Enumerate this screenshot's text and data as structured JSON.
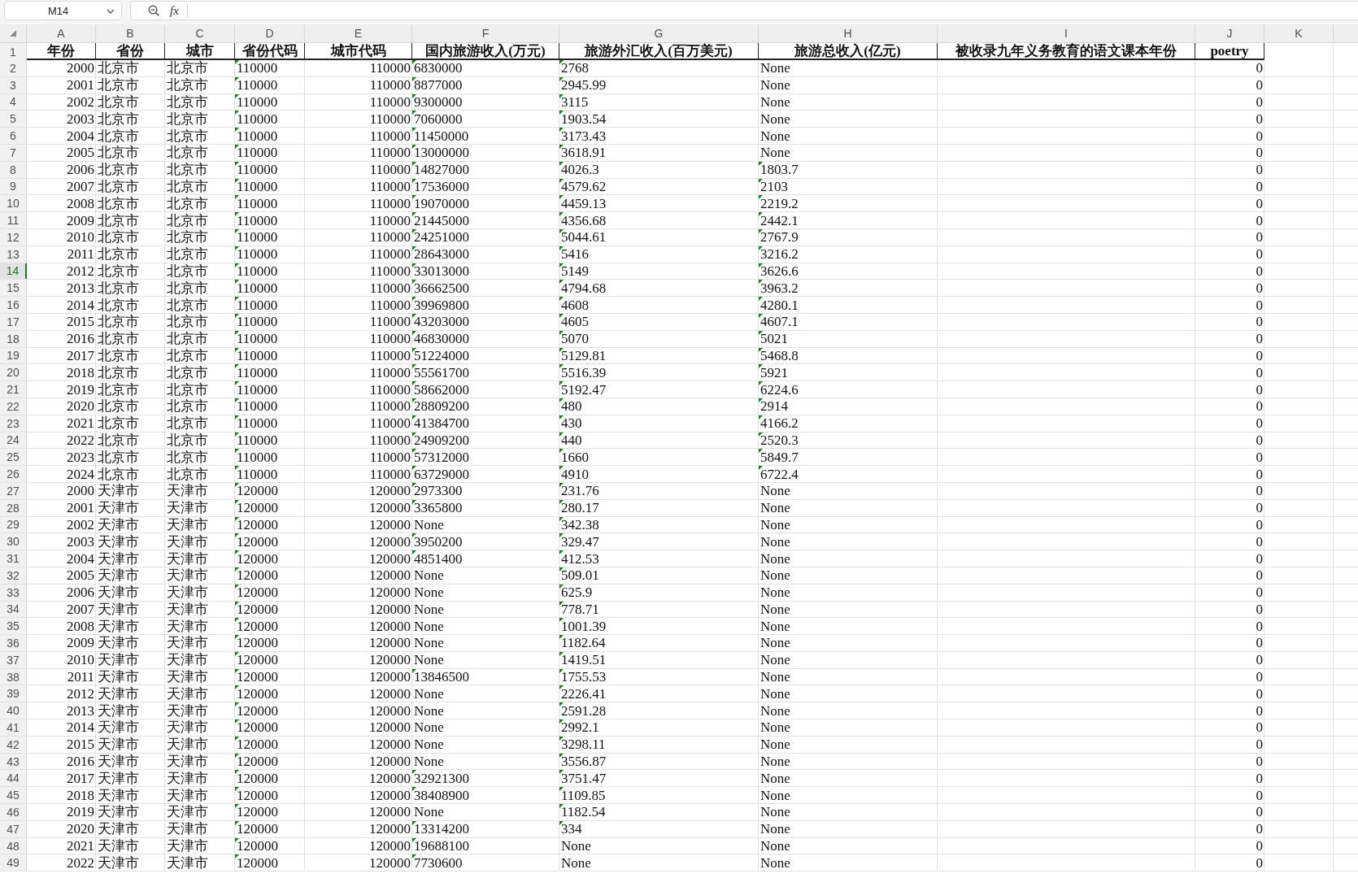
{
  "name_box": {
    "value": "M14"
  },
  "formula_bar": {
    "function_label": "fx"
  },
  "sheet": {
    "columns": [
      {
        "letter": "A",
        "title": "年份",
        "kind": "number"
      },
      {
        "letter": "B",
        "title": "省份",
        "kind": "text"
      },
      {
        "letter": "C",
        "title": "城市",
        "kind": "text"
      },
      {
        "letter": "D",
        "title": "省份代码",
        "kind": "text"
      },
      {
        "letter": "E",
        "title": "城市代码",
        "kind": "number"
      },
      {
        "letter": "F",
        "title": "国内旅游收入(万元)",
        "kind": "text"
      },
      {
        "letter": "G",
        "title": "旅游外汇收入(百万美元)",
        "kind": "text"
      },
      {
        "letter": "H",
        "title": "旅游总收入(亿元)",
        "kind": "text"
      },
      {
        "letter": "I",
        "title": "被收录九年义务教育的语文课本年份",
        "kind": "text"
      },
      {
        "letter": "J",
        "title": "poetry",
        "kind": "number"
      },
      {
        "letter": "K"
      }
    ],
    "title_row": {
      "row": "1",
      "selected": false
    },
    "rows": [
      {
        "row": "2",
        "selected": false,
        "cells": {
          "A": "2000",
          "B": "北京市",
          "C": "北京市",
          "D": "110000",
          "E": "110000",
          "F": "6830000",
          "G": "2768",
          "H": "None",
          "J": "0"
        },
        "flags": {
          "D": true,
          "F": true,
          "G": true,
          "H": false
        }
      },
      {
        "row": "3",
        "selected": false,
        "cells": {
          "A": "2001",
          "B": "北京市",
          "C": "北京市",
          "D": "110000",
          "E": "110000",
          "F": "8877000",
          "G": "2945.99",
          "H": "None",
          "J": "0"
        },
        "flags": {
          "D": true,
          "F": true,
          "G": true,
          "H": false
        }
      },
      {
        "row": "4",
        "selected": false,
        "cells": {
          "A": "2002",
          "B": "北京市",
          "C": "北京市",
          "D": "110000",
          "E": "110000",
          "F": "9300000",
          "G": "3115",
          "H": "None",
          "J": "0"
        },
        "flags": {
          "D": true,
          "F": true,
          "G": true,
          "H": false
        }
      },
      {
        "row": "5",
        "selected": false,
        "cells": {
          "A": "2003",
          "B": "北京市",
          "C": "北京市",
          "D": "110000",
          "E": "110000",
          "F": "7060000",
          "G": "1903.54",
          "H": "None",
          "J": "0"
        },
        "flags": {
          "D": true,
          "F": true,
          "G": true,
          "H": false
        }
      },
      {
        "row": "6",
        "selected": false,
        "cells": {
          "A": "2004",
          "B": "北京市",
          "C": "北京市",
          "D": "110000",
          "E": "110000",
          "F": "11450000",
          "G": "3173.43",
          "H": "None",
          "J": "0"
        },
        "flags": {
          "D": true,
          "F": true,
          "G": true,
          "H": false
        }
      },
      {
        "row": "7",
        "selected": false,
        "cells": {
          "A": "2005",
          "B": "北京市",
          "C": "北京市",
          "D": "110000",
          "E": "110000",
          "F": "13000000",
          "G": "3618.91",
          "H": "None",
          "J": "0"
        },
        "flags": {
          "D": true,
          "F": true,
          "G": true,
          "H": false
        }
      },
      {
        "row": "8",
        "selected": false,
        "cells": {
          "A": "2006",
          "B": "北京市",
          "C": "北京市",
          "D": "110000",
          "E": "110000",
          "F": "14827000",
          "G": "4026.3",
          "H": "1803.7",
          "J": "0"
        },
        "flags": {
          "D": true,
          "F": true,
          "G": true,
          "H": true
        }
      },
      {
        "row": "9",
        "selected": false,
        "cells": {
          "A": "2007",
          "B": "北京市",
          "C": "北京市",
          "D": "110000",
          "E": "110000",
          "F": "17536000",
          "G": "4579.62",
          "H": "2103",
          "J": "0"
        },
        "flags": {
          "D": true,
          "F": true,
          "G": true,
          "H": true
        }
      },
      {
        "row": "10",
        "selected": false,
        "cells": {
          "A": "2008",
          "B": "北京市",
          "C": "北京市",
          "D": "110000",
          "E": "110000",
          "F": "19070000",
          "G": "4459.13",
          "H": "2219.2",
          "J": "0"
        },
        "flags": {
          "D": true,
          "F": true,
          "G": true,
          "H": true
        }
      },
      {
        "row": "11",
        "selected": false,
        "cells": {
          "A": "2009",
          "B": "北京市",
          "C": "北京市",
          "D": "110000",
          "E": "110000",
          "F": "21445000",
          "G": "4356.68",
          "H": "2442.1",
          "J": "0"
        },
        "flags": {
          "D": true,
          "F": true,
          "G": true,
          "H": true
        }
      },
      {
        "row": "12",
        "selected": false,
        "cells": {
          "A": "2010",
          "B": "北京市",
          "C": "北京市",
          "D": "110000",
          "E": "110000",
          "F": "24251000",
          "G": "5044.61",
          "H": "2767.9",
          "J": "0"
        },
        "flags": {
          "D": true,
          "F": true,
          "G": true,
          "H": true
        }
      },
      {
        "row": "13",
        "selected": false,
        "cells": {
          "A": "2011",
          "B": "北京市",
          "C": "北京市",
          "D": "110000",
          "E": "110000",
          "F": "28643000",
          "G": "5416",
          "H": "3216.2",
          "J": "0"
        },
        "flags": {
          "D": true,
          "F": true,
          "G": true,
          "H": true
        }
      },
      {
        "row": "14",
        "selected": true,
        "cells": {
          "A": "2012",
          "B": "北京市",
          "C": "北京市",
          "D": "110000",
          "E": "110000",
          "F": "33013000",
          "G": "5149",
          "H": "3626.6",
          "J": "0"
        },
        "flags": {
          "D": true,
          "F": true,
          "G": true,
          "H": true
        }
      },
      {
        "row": "15",
        "selected": false,
        "cells": {
          "A": "2013",
          "B": "北京市",
          "C": "北京市",
          "D": "110000",
          "E": "110000",
          "F": "36662500",
          "G": "4794.68",
          "H": "3963.2",
          "J": "0"
        },
        "flags": {
          "D": true,
          "F": true,
          "G": true,
          "H": true
        }
      },
      {
        "row": "16",
        "selected": false,
        "cells": {
          "A": "2014",
          "B": "北京市",
          "C": "北京市",
          "D": "110000",
          "E": "110000",
          "F": "39969800",
          "G": "4608",
          "H": "4280.1",
          "J": "0"
        },
        "flags": {
          "D": true,
          "F": true,
          "G": true,
          "H": true
        }
      },
      {
        "row": "17",
        "selected": false,
        "cells": {
          "A": "2015",
          "B": "北京市",
          "C": "北京市",
          "D": "110000",
          "E": "110000",
          "F": "43203000",
          "G": "4605",
          "H": "4607.1",
          "J": "0"
        },
        "flags": {
          "D": true,
          "F": true,
          "G": true,
          "H": true
        }
      },
      {
        "row": "18",
        "selected": false,
        "cells": {
          "A": "2016",
          "B": "北京市",
          "C": "北京市",
          "D": "110000",
          "E": "110000",
          "F": "46830000",
          "G": "5070",
          "H": "5021",
          "J": "0"
        },
        "flags": {
          "D": true,
          "F": true,
          "G": true,
          "H": true
        }
      },
      {
        "row": "19",
        "selected": false,
        "cells": {
          "A": "2017",
          "B": "北京市",
          "C": "北京市",
          "D": "110000",
          "E": "110000",
          "F": "51224000",
          "G": "5129.81",
          "H": "5468.8",
          "J": "0"
        },
        "flags": {
          "D": true,
          "F": true,
          "G": true,
          "H": true
        }
      },
      {
        "row": "20",
        "selected": false,
        "cells": {
          "A": "2018",
          "B": "北京市",
          "C": "北京市",
          "D": "110000",
          "E": "110000",
          "F": "55561700",
          "G": "5516.39",
          "H": "5921",
          "J": "0"
        },
        "flags": {
          "D": true,
          "F": true,
          "G": true,
          "H": true
        }
      },
      {
        "row": "21",
        "selected": false,
        "cells": {
          "A": "2019",
          "B": "北京市",
          "C": "北京市",
          "D": "110000",
          "E": "110000",
          "F": "58662000",
          "G": "5192.47",
          "H": "6224.6",
          "J": "0"
        },
        "flags": {
          "D": true,
          "F": true,
          "G": true,
          "H": true
        }
      },
      {
        "row": "22",
        "selected": false,
        "cells": {
          "A": "2020",
          "B": "北京市",
          "C": "北京市",
          "D": "110000",
          "E": "110000",
          "F": "28809200",
          "G": "480",
          "H": "2914",
          "J": "0"
        },
        "flags": {
          "D": true,
          "F": true,
          "G": true,
          "H": true
        }
      },
      {
        "row": "23",
        "selected": false,
        "cells": {
          "A": "2021",
          "B": "北京市",
          "C": "北京市",
          "D": "110000",
          "E": "110000",
          "F": "41384700",
          "G": "430",
          "H": "4166.2",
          "J": "0"
        },
        "flags": {
          "D": true,
          "F": true,
          "G": true,
          "H": true
        }
      },
      {
        "row": "24",
        "selected": false,
        "cells": {
          "A": "2022",
          "B": "北京市",
          "C": "北京市",
          "D": "110000",
          "E": "110000",
          "F": "24909200",
          "G": "440",
          "H": "2520.3",
          "J": "0"
        },
        "flags": {
          "D": true,
          "F": true,
          "G": true,
          "H": true
        }
      },
      {
        "row": "25",
        "selected": false,
        "cells": {
          "A": "2023",
          "B": "北京市",
          "C": "北京市",
          "D": "110000",
          "E": "110000",
          "F": "57312000",
          "G": "1660",
          "H": "5849.7",
          "J": "0"
        },
        "flags": {
          "D": true,
          "F": true,
          "G": true,
          "H": true
        }
      },
      {
        "row": "26",
        "selected": false,
        "cells": {
          "A": "2024",
          "B": "北京市",
          "C": "北京市",
          "D": "110000",
          "E": "110000",
          "F": "63729000",
          "G": "4910",
          "H": "6722.4",
          "J": "0"
        },
        "flags": {
          "D": true,
          "F": true,
          "G": true,
          "H": true
        }
      },
      {
        "row": "27",
        "selected": false,
        "cells": {
          "A": "2000",
          "B": "天津市",
          "C": "天津市",
          "D": "120000",
          "E": "120000",
          "F": "2973300",
          "G": "231.76",
          "H": "None",
          "J": "0"
        },
        "flags": {
          "D": true,
          "F": true,
          "G": true,
          "H": false
        }
      },
      {
        "row": "28",
        "selected": false,
        "cells": {
          "A": "2001",
          "B": "天津市",
          "C": "天津市",
          "D": "120000",
          "E": "120000",
          "F": "3365800",
          "G": "280.17",
          "H": "None",
          "J": "0"
        },
        "flags": {
          "D": true,
          "F": true,
          "G": true,
          "H": false
        }
      },
      {
        "row": "29",
        "selected": false,
        "cells": {
          "A": "2002",
          "B": "天津市",
          "C": "天津市",
          "D": "120000",
          "E": "120000",
          "F": "None",
          "G": "342.38",
          "H": "None",
          "J": "0"
        },
        "flags": {
          "D": true,
          "F": false,
          "G": true,
          "H": false
        }
      },
      {
        "row": "30",
        "selected": false,
        "cells": {
          "A": "2003",
          "B": "天津市",
          "C": "天津市",
          "D": "120000",
          "E": "120000",
          "F": "3950200",
          "G": "329.47",
          "H": "None",
          "J": "0"
        },
        "flags": {
          "D": true,
          "F": true,
          "G": true,
          "H": false
        }
      },
      {
        "row": "31",
        "selected": false,
        "cells": {
          "A": "2004",
          "B": "天津市",
          "C": "天津市",
          "D": "120000",
          "E": "120000",
          "F": "4851400",
          "G": "412.53",
          "H": "None",
          "J": "0"
        },
        "flags": {
          "D": true,
          "F": true,
          "G": true,
          "H": false
        }
      },
      {
        "row": "32",
        "selected": false,
        "cells": {
          "A": "2005",
          "B": "天津市",
          "C": "天津市",
          "D": "120000",
          "E": "120000",
          "F": "None",
          "G": "509.01",
          "H": "None",
          "J": "0"
        },
        "flags": {
          "D": true,
          "F": false,
          "G": true,
          "H": false
        }
      },
      {
        "row": "33",
        "selected": false,
        "cells": {
          "A": "2006",
          "B": "天津市",
          "C": "天津市",
          "D": "120000",
          "E": "120000",
          "F": "None",
          "G": "625.9",
          "H": "None",
          "J": "0"
        },
        "flags": {
          "D": true,
          "F": false,
          "G": true,
          "H": false
        }
      },
      {
        "row": "34",
        "selected": false,
        "cells": {
          "A": "2007",
          "B": "天津市",
          "C": "天津市",
          "D": "120000",
          "E": "120000",
          "F": "None",
          "G": "778.71",
          "H": "None",
          "J": "0"
        },
        "flags": {
          "D": true,
          "F": false,
          "G": true,
          "H": false
        }
      },
      {
        "row": "35",
        "selected": false,
        "cells": {
          "A": "2008",
          "B": "天津市",
          "C": "天津市",
          "D": "120000",
          "E": "120000",
          "F": "None",
          "G": "1001.39",
          "H": "None",
          "J": "0"
        },
        "flags": {
          "D": true,
          "F": false,
          "G": true,
          "H": false
        }
      },
      {
        "row": "36",
        "selected": false,
        "cells": {
          "A": "2009",
          "B": "天津市",
          "C": "天津市",
          "D": "120000",
          "E": "120000",
          "F": "None",
          "G": "1182.64",
          "H": "None",
          "J": "0"
        },
        "flags": {
          "D": true,
          "F": false,
          "G": true,
          "H": false
        }
      },
      {
        "row": "37",
        "selected": false,
        "cells": {
          "A": "2010",
          "B": "天津市",
          "C": "天津市",
          "D": "120000",
          "E": "120000",
          "F": "None",
          "G": "1419.51",
          "H": "None",
          "J": "0"
        },
        "flags": {
          "D": true,
          "F": false,
          "G": true,
          "H": false
        }
      },
      {
        "row": "38",
        "selected": false,
        "cells": {
          "A": "2011",
          "B": "天津市",
          "C": "天津市",
          "D": "120000",
          "E": "120000",
          "F": "13846500",
          "G": "1755.53",
          "H": "None",
          "J": "0"
        },
        "flags": {
          "D": true,
          "F": true,
          "G": true,
          "H": false
        }
      },
      {
        "row": "39",
        "selected": false,
        "cells": {
          "A": "2012",
          "B": "天津市",
          "C": "天津市",
          "D": "120000",
          "E": "120000",
          "F": "None",
          "G": "2226.41",
          "H": "None",
          "J": "0"
        },
        "flags": {
          "D": true,
          "F": false,
          "G": true,
          "H": false
        }
      },
      {
        "row": "40",
        "selected": false,
        "cells": {
          "A": "2013",
          "B": "天津市",
          "C": "天津市",
          "D": "120000",
          "E": "120000",
          "F": "None",
          "G": "2591.28",
          "H": "None",
          "J": "0"
        },
        "flags": {
          "D": true,
          "F": false,
          "G": true,
          "H": false
        }
      },
      {
        "row": "41",
        "selected": false,
        "cells": {
          "A": "2014",
          "B": "天津市",
          "C": "天津市",
          "D": "120000",
          "E": "120000",
          "F": "None",
          "G": "2992.1",
          "H": "None",
          "J": "0"
        },
        "flags": {
          "D": true,
          "F": false,
          "G": true,
          "H": false
        }
      },
      {
        "row": "42",
        "selected": false,
        "cells": {
          "A": "2015",
          "B": "天津市",
          "C": "天津市",
          "D": "120000",
          "E": "120000",
          "F": "None",
          "G": "3298.11",
          "H": "None",
          "J": "0"
        },
        "flags": {
          "D": true,
          "F": false,
          "G": true,
          "H": false
        }
      },
      {
        "row": "43",
        "selected": false,
        "cells": {
          "A": "2016",
          "B": "天津市",
          "C": "天津市",
          "D": "120000",
          "E": "120000",
          "F": "None",
          "G": "3556.87",
          "H": "None",
          "J": "0"
        },
        "flags": {
          "D": true,
          "F": false,
          "G": true,
          "H": false
        }
      },
      {
        "row": "44",
        "selected": false,
        "cells": {
          "A": "2017",
          "B": "天津市",
          "C": "天津市",
          "D": "120000",
          "E": "120000",
          "F": "32921300",
          "G": "3751.47",
          "H": "None",
          "J": "0"
        },
        "flags": {
          "D": true,
          "F": true,
          "G": true,
          "H": false
        }
      },
      {
        "row": "45",
        "selected": false,
        "cells": {
          "A": "2018",
          "B": "天津市",
          "C": "天津市",
          "D": "120000",
          "E": "120000",
          "F": "38408900",
          "G": "1109.85",
          "H": "None",
          "J": "0"
        },
        "flags": {
          "D": true,
          "F": true,
          "G": true,
          "H": false
        }
      },
      {
        "row": "46",
        "selected": false,
        "cells": {
          "A": "2019",
          "B": "天津市",
          "C": "天津市",
          "D": "120000",
          "E": "120000",
          "F": "None",
          "G": "1182.54",
          "H": "None",
          "J": "0"
        },
        "flags": {
          "D": true,
          "F": false,
          "G": true,
          "H": false
        }
      },
      {
        "row": "47",
        "selected": false,
        "cells": {
          "A": "2020",
          "B": "天津市",
          "C": "天津市",
          "D": "120000",
          "E": "120000",
          "F": "13314200",
          "G": "334",
          "H": "None",
          "J": "0"
        },
        "flags": {
          "D": true,
          "F": true,
          "G": true,
          "H": false
        }
      },
      {
        "row": "48",
        "selected": false,
        "cells": {
          "A": "2021",
          "B": "天津市",
          "C": "天津市",
          "D": "120000",
          "E": "120000",
          "F": "19688100",
          "G": "None",
          "H": "None",
          "J": "0"
        },
        "flags": {
          "D": true,
          "F": true,
          "G": false,
          "H": false
        }
      },
      {
        "row": "49",
        "selected": false,
        "cells": {
          "A": "2022",
          "B": "天津市",
          "C": "天津市",
          "D": "120000",
          "E": "120000",
          "F": "7730600",
          "G": "None",
          "H": "None",
          "J": "0"
        },
        "flags": {
          "D": true,
          "F": true,
          "G": false,
          "H": false
        }
      }
    ]
  }
}
